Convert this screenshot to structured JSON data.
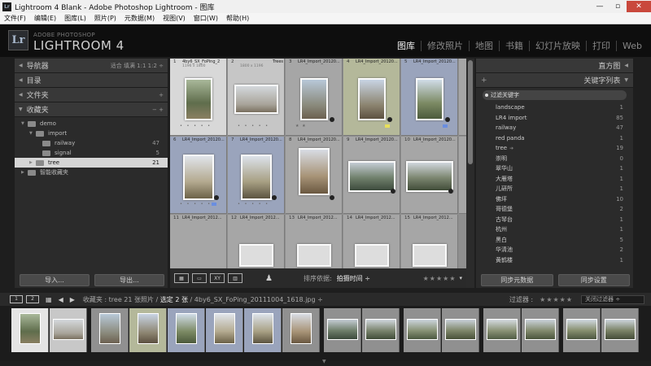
{
  "window": {
    "title": "Lightroom 4 Blank - Adobe Photoshop Lightroom - 图库",
    "app_icon": "Lr",
    "controls": [
      "minimize-icon",
      "maximize-icon",
      "close-icon"
    ]
  },
  "menu": [
    "文件(F)",
    "编辑(E)",
    "图库(L)",
    "照片(P)",
    "元数据(M)",
    "视图(V)",
    "窗口(W)",
    "帮助(H)"
  ],
  "identity": {
    "logo": "Lr",
    "sub": "ADOBE PHOTOSHOP",
    "main": "LIGHTROOM 4"
  },
  "modules": [
    "图库",
    "修改照片",
    "地图",
    "书籍",
    "幻灯片放映",
    "打印",
    "Web"
  ],
  "active_module": "图库",
  "left_panel": {
    "navigator": "导航器",
    "navigator_opts": "适合  填满  1:1  1:2 ÷",
    "catalog": "目录",
    "folders": "文件夹",
    "collections": "收藏夹",
    "tree": [
      {
        "label": "demo",
        "count": ""
      },
      {
        "label": "import",
        "count": ""
      },
      {
        "label": "railway",
        "count": "47"
      },
      {
        "label": "signal",
        "count": "5"
      },
      {
        "label": "tree",
        "count": "21"
      },
      {
        "label": "智能收藏夹",
        "count": ""
      }
    ],
    "import_button": "导入...",
    "export_button": "导出..."
  },
  "grid": {
    "cells": [
      {
        "num": "1",
        "name": "4by6_SX_FoPing_2",
        "dim": "1196 x 1800",
        "state": "primary"
      },
      {
        "num": "2",
        "name": "Trees",
        "dim": "1800 x 1196",
        "state": "sel"
      },
      {
        "num": "3",
        "name": "LR4_Import_20120...",
        "dim": "",
        "state": ""
      },
      {
        "num": "4",
        "name": "LR4_Import_20120...",
        "dim": "",
        "state": ""
      },
      {
        "num": "5",
        "name": "LR4_Import_20120...",
        "dim": "",
        "state": ""
      },
      {
        "num": "6",
        "name": "LR4_Import_20120...",
        "dim": "",
        "state": ""
      },
      {
        "num": "7",
        "name": "LR4_Import_20120...",
        "dim": "",
        "state": ""
      },
      {
        "num": "8",
        "name": "LR4_Import_20120...",
        "dim": "",
        "state": ""
      },
      {
        "num": "9",
        "name": "LR4_Import_20120...",
        "dim": "",
        "state": ""
      },
      {
        "num": "10",
        "name": "LR4_Import_20120...",
        "dim": "",
        "state": ""
      },
      {
        "num": "11",
        "name": "LR4_Import_2012...",
        "dim": "",
        "state": ""
      },
      {
        "num": "12",
        "name": "LR4_Import_2012...",
        "dim": "",
        "state": ""
      },
      {
        "num": "13",
        "name": "LR4_Import_2012...",
        "dim": "",
        "state": ""
      },
      {
        "num": "14",
        "name": "LR4_Import_2012...",
        "dim": "",
        "state": ""
      },
      {
        "num": "15",
        "name": "LR4_Import_2012...",
        "dim": "",
        "state": ""
      }
    ]
  },
  "toolbar": {
    "sort_label": "排序依据:",
    "sort_value": "拍摄时间 ÷",
    "stars": "★★★★★"
  },
  "right_panel": {
    "histogram": "直方图",
    "keyword_list": "关键字列表",
    "filter_placeholder": "过滤关键字",
    "keywords": [
      {
        "label": "landscape",
        "count": "1"
      },
      {
        "label": "LR4 import",
        "count": "85"
      },
      {
        "label": "railway",
        "count": "47"
      },
      {
        "label": "red panda",
        "count": "1"
      },
      {
        "label": "tree",
        "count": "19"
      },
      {
        "label": "崇明",
        "count": "0"
      },
      {
        "label": "翠华山",
        "count": "1"
      },
      {
        "label": "大雁塔",
        "count": "1"
      },
      {
        "label": "儿研所",
        "count": "1"
      },
      {
        "label": "佛坪",
        "count": "10"
      },
      {
        "label": "哥德堡",
        "count": "2"
      },
      {
        "label": "古琴台",
        "count": "1"
      },
      {
        "label": "杭州",
        "count": "1"
      },
      {
        "label": "黑白",
        "count": "5"
      },
      {
        "label": "华清池",
        "count": "2"
      },
      {
        "label": "黄鹤楼",
        "count": "1"
      }
    ],
    "sync_metadata": "同步元数据",
    "sync_settings": "同步设置"
  },
  "filmstrip_bar": {
    "screen1": "1",
    "screen2": "2",
    "breadcrumb_prefix": "收藏夹 : tree",
    "breadcrumb_count": "21 张照片 /",
    "breadcrumb_selected": "选定 2 张",
    "breadcrumb_file": "/ 4by6_SX_FoPing_20111004_1618.jpg ÷",
    "filter_label": "过滤器 :",
    "filter_stars": "★★★★★",
    "filter_value": "关闭过滤器 ÷"
  },
  "colors": {
    "accent_yellow": "#e8e05a",
    "accent_blue": "#6a8ee0",
    "title_bar": "#f0f0f0",
    "close": "#c9483c"
  }
}
